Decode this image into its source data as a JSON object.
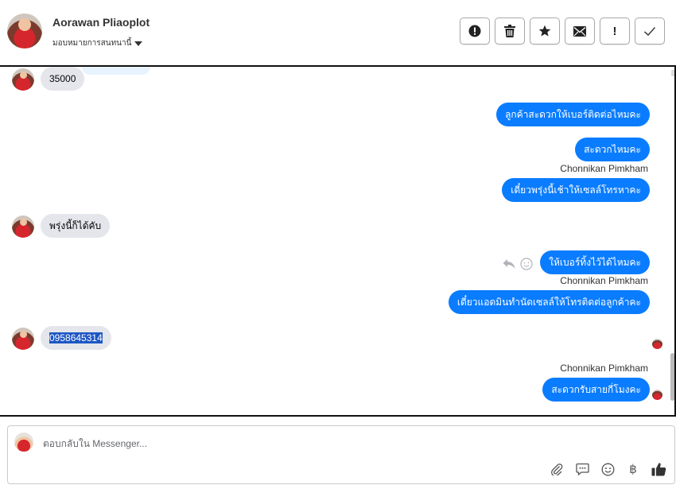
{
  "header": {
    "name": "Aorawan Pliaoplot",
    "assign_label": "มอบหมายการสนทนานี้"
  },
  "toolbar": {
    "buttons": [
      "alert-icon",
      "trash-icon",
      "star-icon",
      "envelope-icon",
      "exclamation-icon",
      "check-icon"
    ],
    "exclamation_text": "!"
  },
  "messages": [
    {
      "side": "in",
      "text": "35000"
    },
    {
      "side": "out",
      "text": "ลูกค้าสะดวกให้เบอร์ติดต่อไหมคะ"
    },
    {
      "side": "out",
      "text": "สะดวกไหมคะ"
    },
    {
      "side": "out",
      "sender": "Chonnikan Pimkham",
      "text": "เดี๋ยวพรุ่งนี้เช้าให้เซลล์โทรหาคะ"
    },
    {
      "side": "in",
      "text": "พรุ่งนี้ก็ได้คับ"
    },
    {
      "side": "out",
      "text": "ให้เบอร์ทิ้งไว้ได้ไหมคะ"
    },
    {
      "side": "out",
      "sender": "Chonnikan Pimkham",
      "text": "เดี๋ยวแอดมินทำนัดเซลล์ให้โทรติดต่อลูกค้าคะ"
    },
    {
      "side": "in",
      "text": "0958645314"
    },
    {
      "side": "out",
      "sender": "Chonnikan Pimkham",
      "text": "สะดวกรับสายกี่โมงคะ"
    }
  ],
  "composer": {
    "placeholder": "ตอบกลับใน Messenger...",
    "baht_symbol": "฿"
  }
}
